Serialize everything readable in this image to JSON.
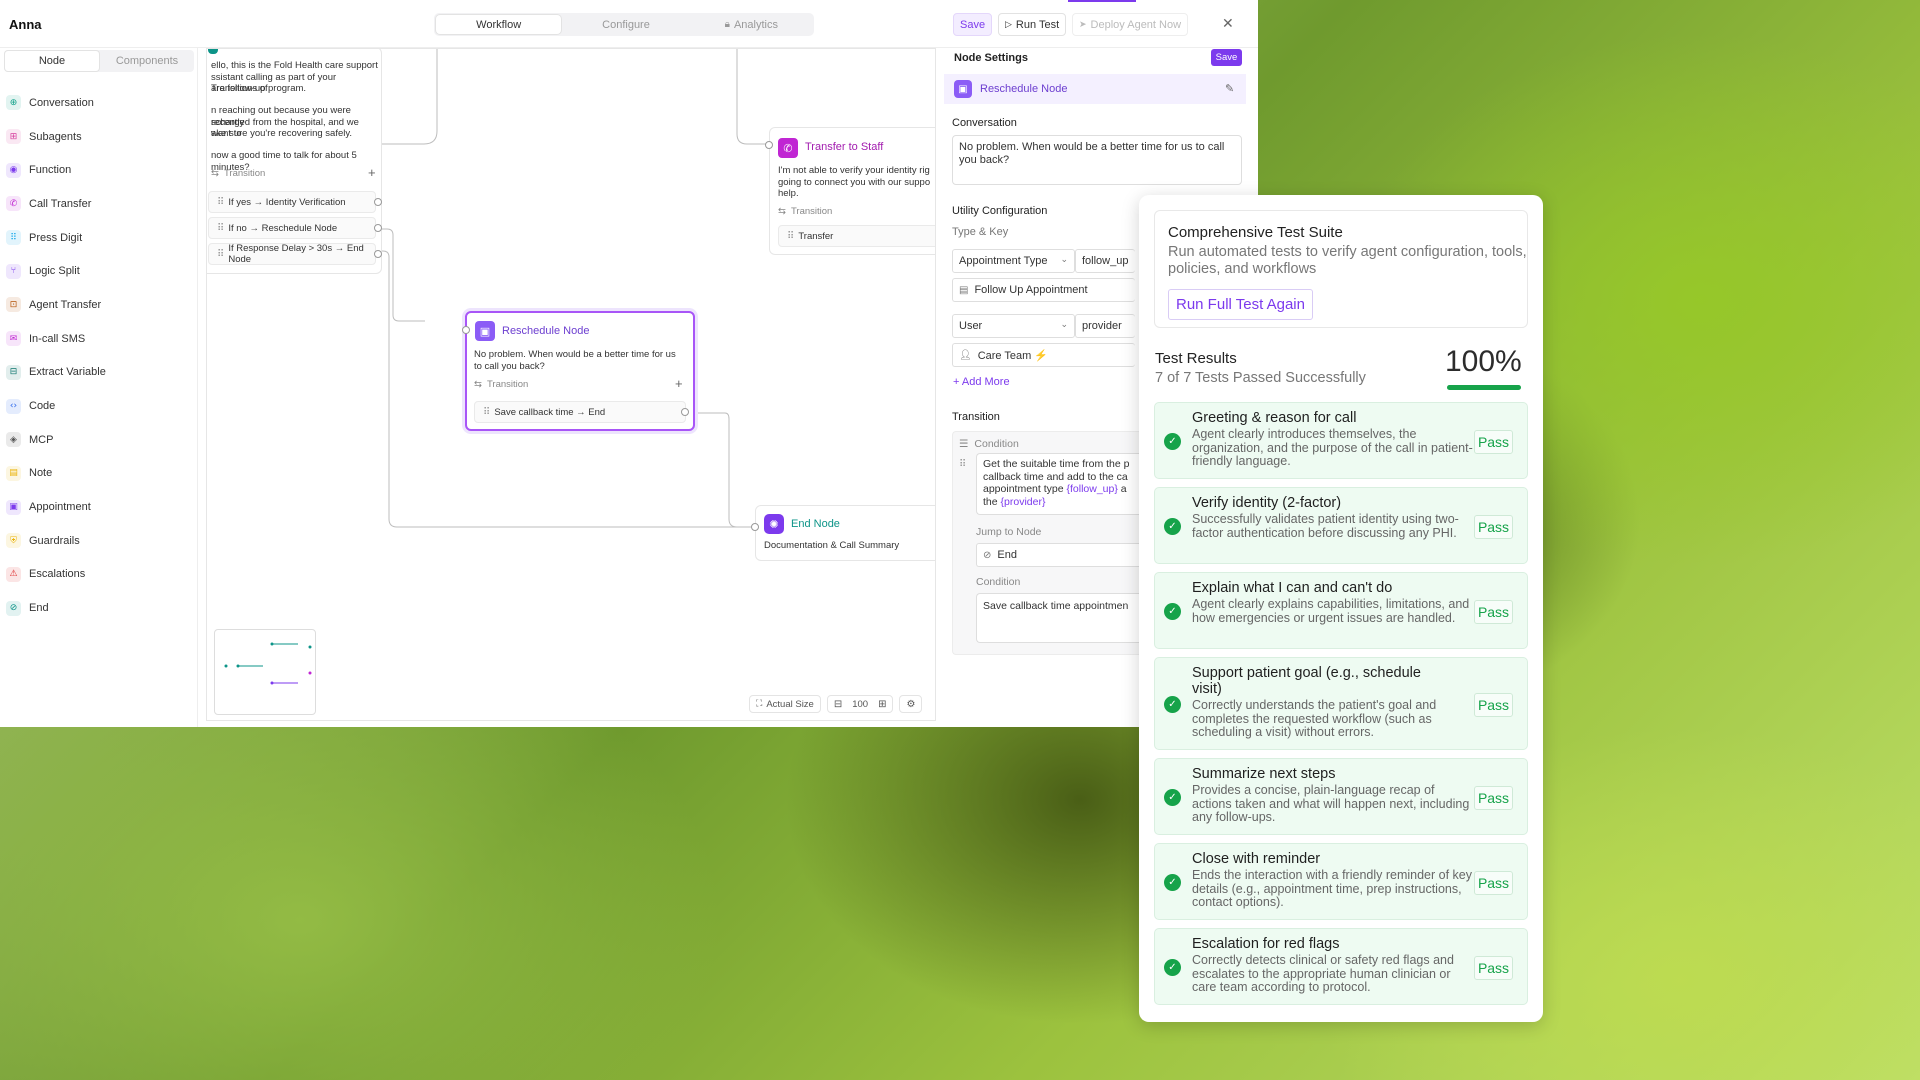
{
  "app": {
    "title": "Anna",
    "tabs": [
      {
        "label": "Workflow",
        "icon": ""
      },
      {
        "label": "Configure",
        "icon": ""
      },
      {
        "label": "Analytics",
        "icon": "lock-icon"
      }
    ],
    "save_label": "Save",
    "run_test_label": "Run Test",
    "deploy_label": "Deploy Agent Now",
    "accent_color": "#7c3aed"
  },
  "palette": {
    "tabs": [
      "Node",
      "Components"
    ],
    "items": [
      {
        "label": "Conversation",
        "icon": "conversation-icon",
        "color": "#14a38b"
      },
      {
        "label": "Subagents",
        "icon": "subagents-icon",
        "color": "#d6409f"
      },
      {
        "label": "Function",
        "icon": "function-icon",
        "color": "#7c3aed"
      },
      {
        "label": "Call Transfer",
        "icon": "call-transfer-icon",
        "color": "#c026d3"
      },
      {
        "label": "Press Digit",
        "icon": "press-digit-icon",
        "color": "#0ea5e9"
      },
      {
        "label": "Logic Split",
        "icon": "logic-split-icon",
        "color": "#7c3aed"
      },
      {
        "label": "Agent Transfer",
        "icon": "agent-transfer-icon",
        "color": "#b45309"
      },
      {
        "label": "In-call SMS",
        "icon": "sms-icon",
        "color": "#c026d3"
      },
      {
        "label": "Extract Variable",
        "icon": "extract-variable-icon",
        "color": "#0f766e"
      },
      {
        "label": "Code",
        "icon": "code-icon",
        "color": "#2563eb"
      },
      {
        "label": "MCP",
        "icon": "mcp-icon",
        "color": "#555555"
      },
      {
        "label": "Note",
        "icon": "note-icon",
        "color": "#eab308"
      },
      {
        "label": "Appointment",
        "icon": "appointment-icon",
        "color": "#7c3aed"
      },
      {
        "label": "Guardrails",
        "icon": "guardrails-icon",
        "color": "#eab308"
      },
      {
        "label": "Escalations",
        "icon": "escalations-icon",
        "color": "#dc2626"
      },
      {
        "label": "End",
        "icon": "end-icon",
        "color": "#0d9488"
      }
    ]
  },
  "canvas": {
    "start_node": {
      "lines": [
        "ello, this is the Fold Health care support",
        "ssistant calling as part of your Transitions of",
        "are follow-up program.",
        "",
        "n reaching out because you were recently",
        "scharged from the hospital, and we want to",
        "ake sure you're recovering safely.",
        "",
        "now a good time to talk for about 5 minutes?"
      ],
      "transition_label": "Transition",
      "transitions": [
        "If yes → Identity Verification",
        "If no → Reschedule Node",
        "If Response Delay > 30s → End Node"
      ]
    },
    "transfer_node": {
      "title": "Transfer to Staff",
      "lines": [
        "I'm not able to verify your identity rig",
        "going to connect you with our suppo",
        "help."
      ],
      "transition_label": "Transition",
      "transition": "Transfer"
    },
    "reschedule_node": {
      "title": "Reschedule Node",
      "lines": [
        "No problem. When would be a better time for us",
        "to call you back?"
      ],
      "transition_label": "Transition",
      "transition": "Save callback time → End"
    },
    "end_node": {
      "title": "End Node",
      "subtitle": "Documentation & Call Summary"
    },
    "zoom": {
      "actual_size": "Actual Size",
      "level": "100"
    }
  },
  "settings": {
    "title": "Node Settings",
    "save_label": "Save",
    "node_name": "Reschedule Node",
    "conversation_label": "Conversation",
    "conversation_text": "No problem. When would be a better time for us to call you back?",
    "utility_label": "Utility Configuration",
    "type_key_label": "Type & Key",
    "type_select": "Appointment Type",
    "type_key": "follow_up",
    "type_value": "Follow Up Appointment",
    "user_select": "User",
    "user_key": "provider",
    "user_value": "Care Team ⚡",
    "add_more": "+ Add More",
    "transition_label": "Transition",
    "condition_label": "Condition",
    "condition_text_1": "Get the suitable time from the p",
    "condition_text_2": "callback time  and add to the ca",
    "condition_text_3a": "appointment type ",
    "condition_var_1": "{follow_up}",
    "condition_text_3b": " a",
    "condition_text_4a": "the ",
    "condition_var_2": "{provider}",
    "jump_label": "Jump to Node",
    "jump_value": "End",
    "condition2_label": "Condition",
    "condition2_value": "Save callback time appointmen"
  },
  "test_panel": {
    "suite_title": "Comprehensive Test Suite",
    "suite_desc": "Run automated tests to verify agent configuration, tools, policies, and workflows",
    "rerun_label": "Run Full Test Again",
    "results_title": "Test Results",
    "results_sub": "7 of 7 Tests Passed Successfully",
    "percent_label": "100%",
    "percent_value": 1.0,
    "pass_color": "#16a34a",
    "tests": [
      {
        "name": "Greeting & reason for call",
        "desc": "Agent clearly introduces themselves, the organization, and the purpose of the call in patient-friendly language.",
        "status": "Pass"
      },
      {
        "name": "Verify identity (2-factor)",
        "desc": "Successfully validates patient identity using two-factor authentication before discussing any PHI.",
        "status": "Pass"
      },
      {
        "name": "Explain what I can and can't do",
        "desc": "Agent clearly explains capabilities, limitations, and how emergencies or urgent issues are handled.",
        "status": "Pass"
      },
      {
        "name": "Support patient goal (e.g., schedule visit)",
        "desc": "Correctly understands the patient's goal and completes the requested workflow (such as scheduling a visit) without errors.",
        "status": "Pass"
      },
      {
        "name": "Summarize next steps",
        "desc": "Provides a concise, plain-language recap of actions taken and what will happen next, including any follow-ups.",
        "status": "Pass"
      },
      {
        "name": "Close with reminder",
        "desc": "Ends the interaction with a friendly reminder of key details (e.g., appointment time, prep instructions, contact options).",
        "status": "Pass"
      },
      {
        "name": "Escalation for red flags",
        "desc": "Correctly detects clinical or safety red flags and escalates to the appropriate human clinician or care team according to protocol.",
        "status": "Pass"
      }
    ]
  }
}
